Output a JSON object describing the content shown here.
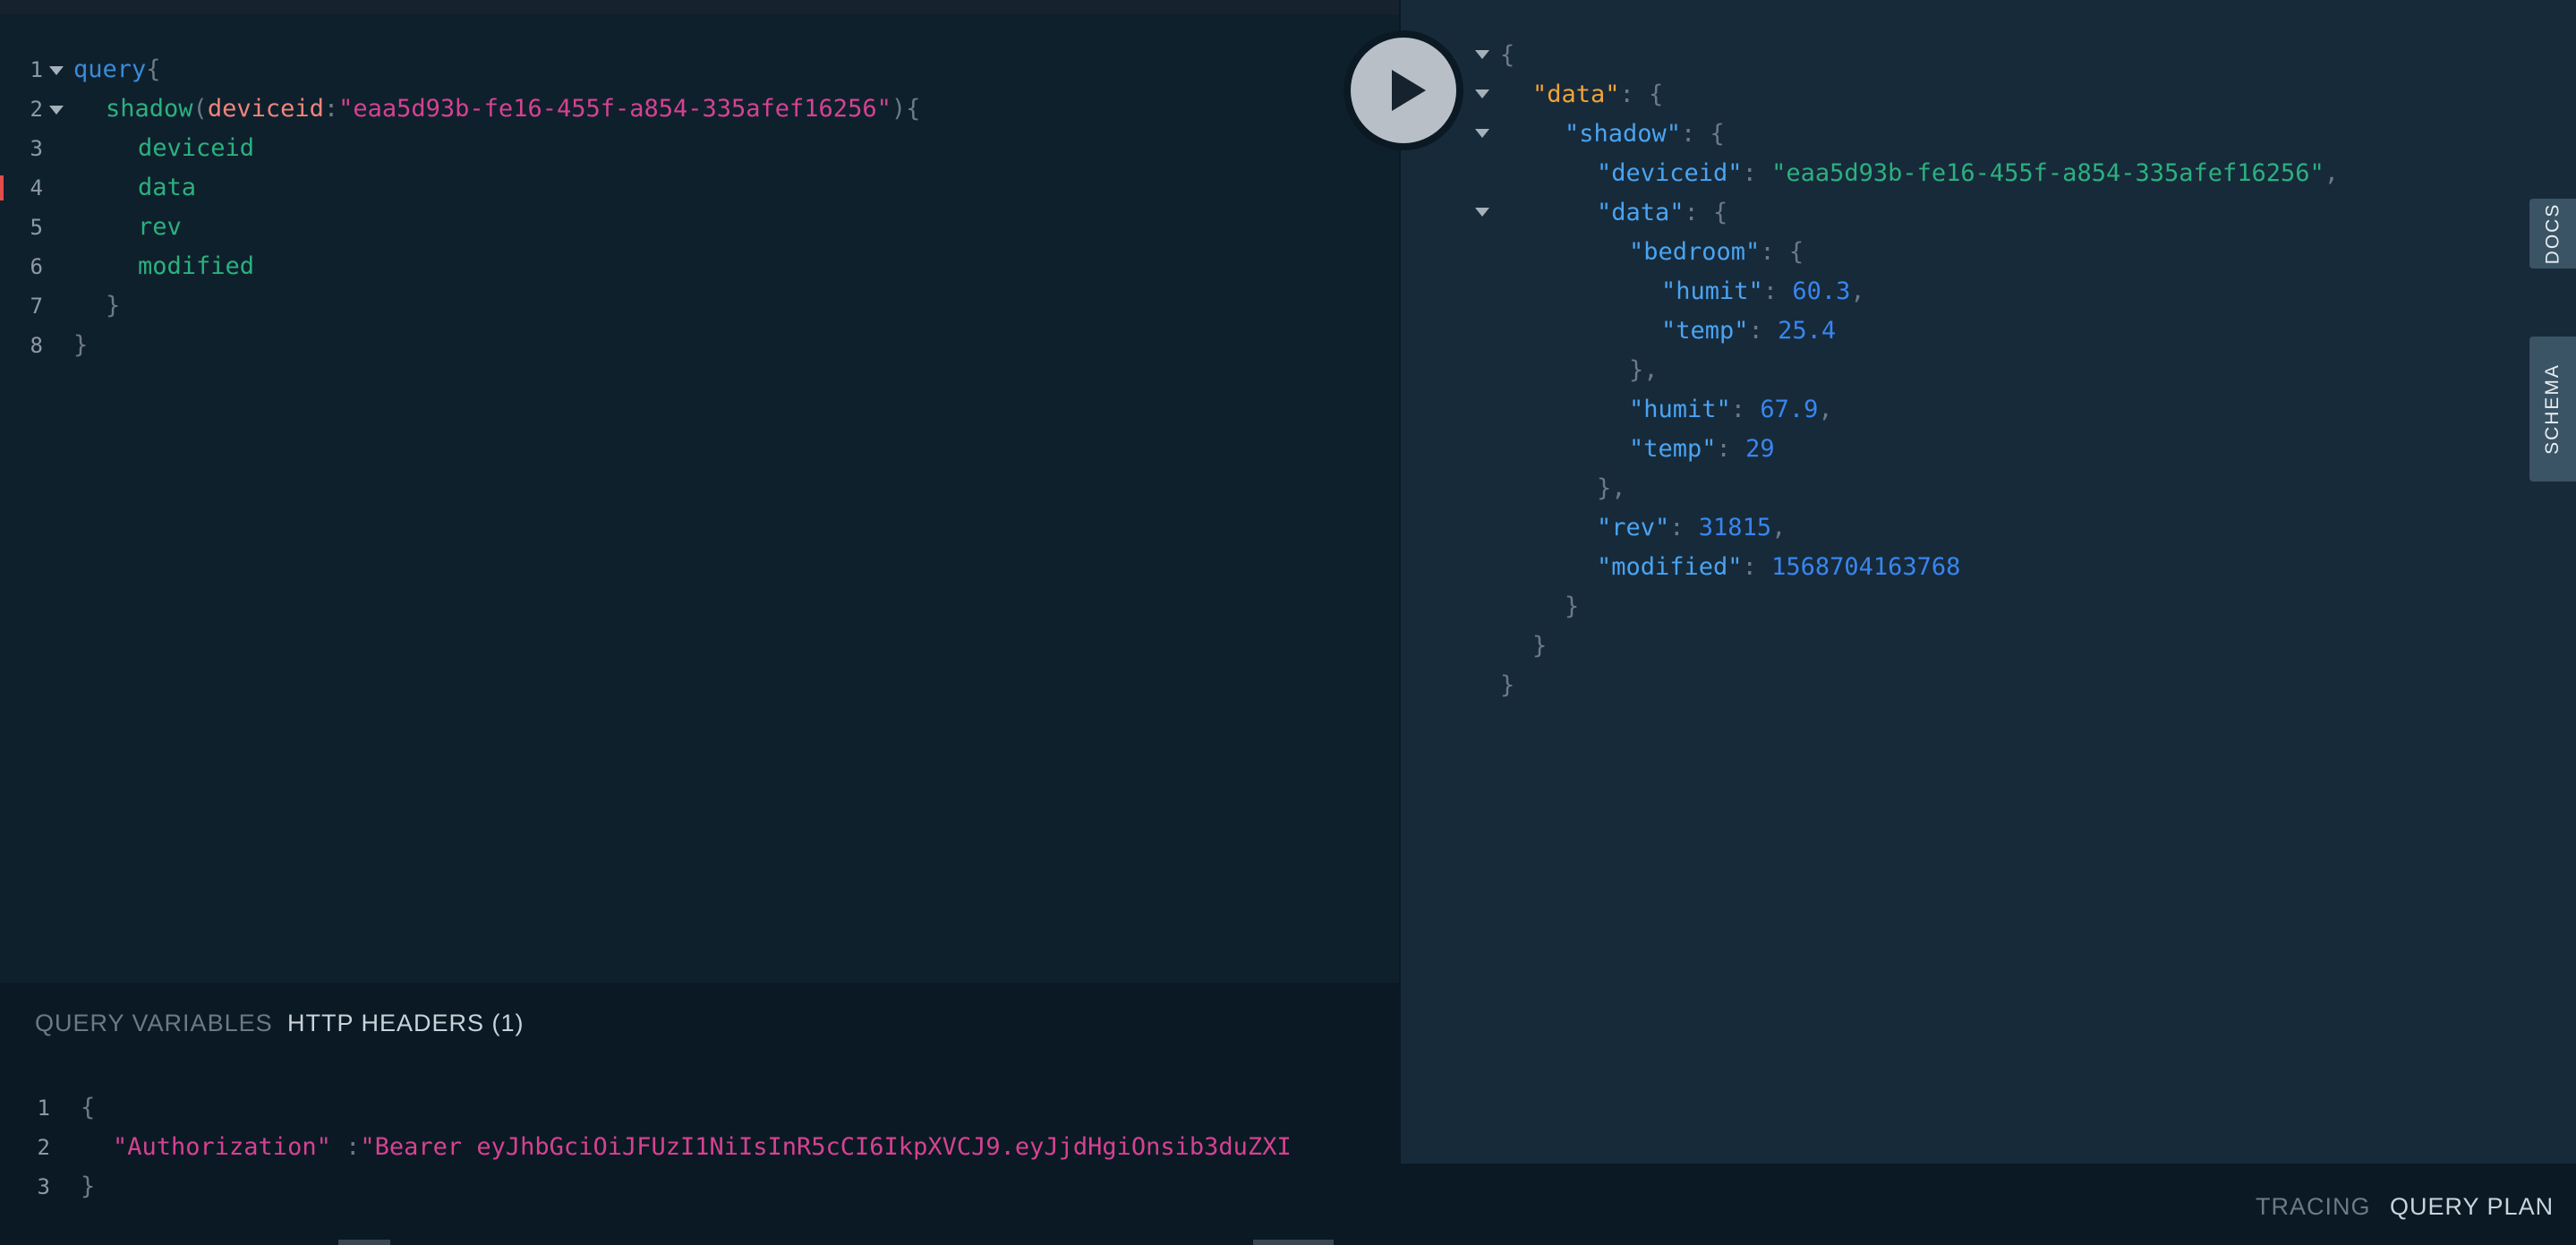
{
  "query_editor": {
    "line_numbers": [
      "1",
      "2",
      "3",
      "4",
      "5",
      "6",
      "7",
      "8"
    ],
    "lines": [
      {
        "kw": "query",
        "punc": "{"
      },
      {
        "field": "shadow",
        "paren_open": "(",
        "arg": "deviceid",
        "colon": ":",
        "str": "\"eaa5d93b-fe16-455f-a854-335afef16256\"",
        "tail": "){"
      },
      {
        "field": "deviceid"
      },
      {
        "field": "data"
      },
      {
        "field": "rev"
      },
      {
        "field": "modified"
      },
      {
        "punc": "}"
      },
      {
        "punc": "}"
      }
    ]
  },
  "run_button": {
    "icon": "play-icon"
  },
  "result": {
    "lines": [
      {
        "p1": "{"
      },
      {
        "k": "\"data\"",
        "p1": ": {"
      },
      {
        "k": "\"shadow\"",
        "p1": ": {"
      },
      {
        "k": "\"deviceid\"",
        "p1": ": ",
        "s": "\"eaa5d93b-fe16-455f-a854-335afef16256\"",
        "p2": ","
      },
      {
        "k": "\"data\"",
        "p1": ": {"
      },
      {
        "k": "\"bedroom\"",
        "p1": ": {"
      },
      {
        "k": "\"humit\"",
        "p1": ": ",
        "n": "60.3",
        "p2": ","
      },
      {
        "k": "\"temp\"",
        "p1": ": ",
        "n": "25.4"
      },
      {
        "p1": "},"
      },
      {
        "k": "\"humit\"",
        "p1": ": ",
        "n": "67.9",
        "p2": ","
      },
      {
        "k": "\"temp\"",
        "p1": ": ",
        "n": "29"
      },
      {
        "p1": "},"
      },
      {
        "k": "\"rev\"",
        "p1": ": ",
        "n": "31815",
        "p2": ","
      },
      {
        "k": "\"modified\"",
        "p1": ": ",
        "n": "1568704163768"
      },
      {
        "p1": "}"
      },
      {
        "p1": "}"
      },
      {
        "p1": "}"
      }
    ]
  },
  "side_tabs": {
    "docs": "DOCS",
    "schema": "SCHEMA"
  },
  "bottom_tabs": {
    "query_variables": "QUERY VARIABLES",
    "http_headers": "HTTP HEADERS (1)"
  },
  "headers_editor": {
    "line_numbers": [
      "1",
      "2",
      "3"
    ],
    "open": "{",
    "key": "\"Authorization\"",
    "colon": " :",
    "value": "\"Bearer eyJhbGciOiJFUzI1NiIsInR5cCI6IkpXVCJ9.eyJjdHgiOnsib3duZXI",
    "close": "}"
  },
  "footer_tabs": {
    "tracing": "TRACING",
    "query_plan": "QUERY PLAN"
  },
  "colors": {
    "accent_keyword": "#3a8bd8",
    "field": "#2bb17e",
    "string": "#d64292",
    "number": "#3886f0",
    "data_key": "#f0a33a"
  }
}
